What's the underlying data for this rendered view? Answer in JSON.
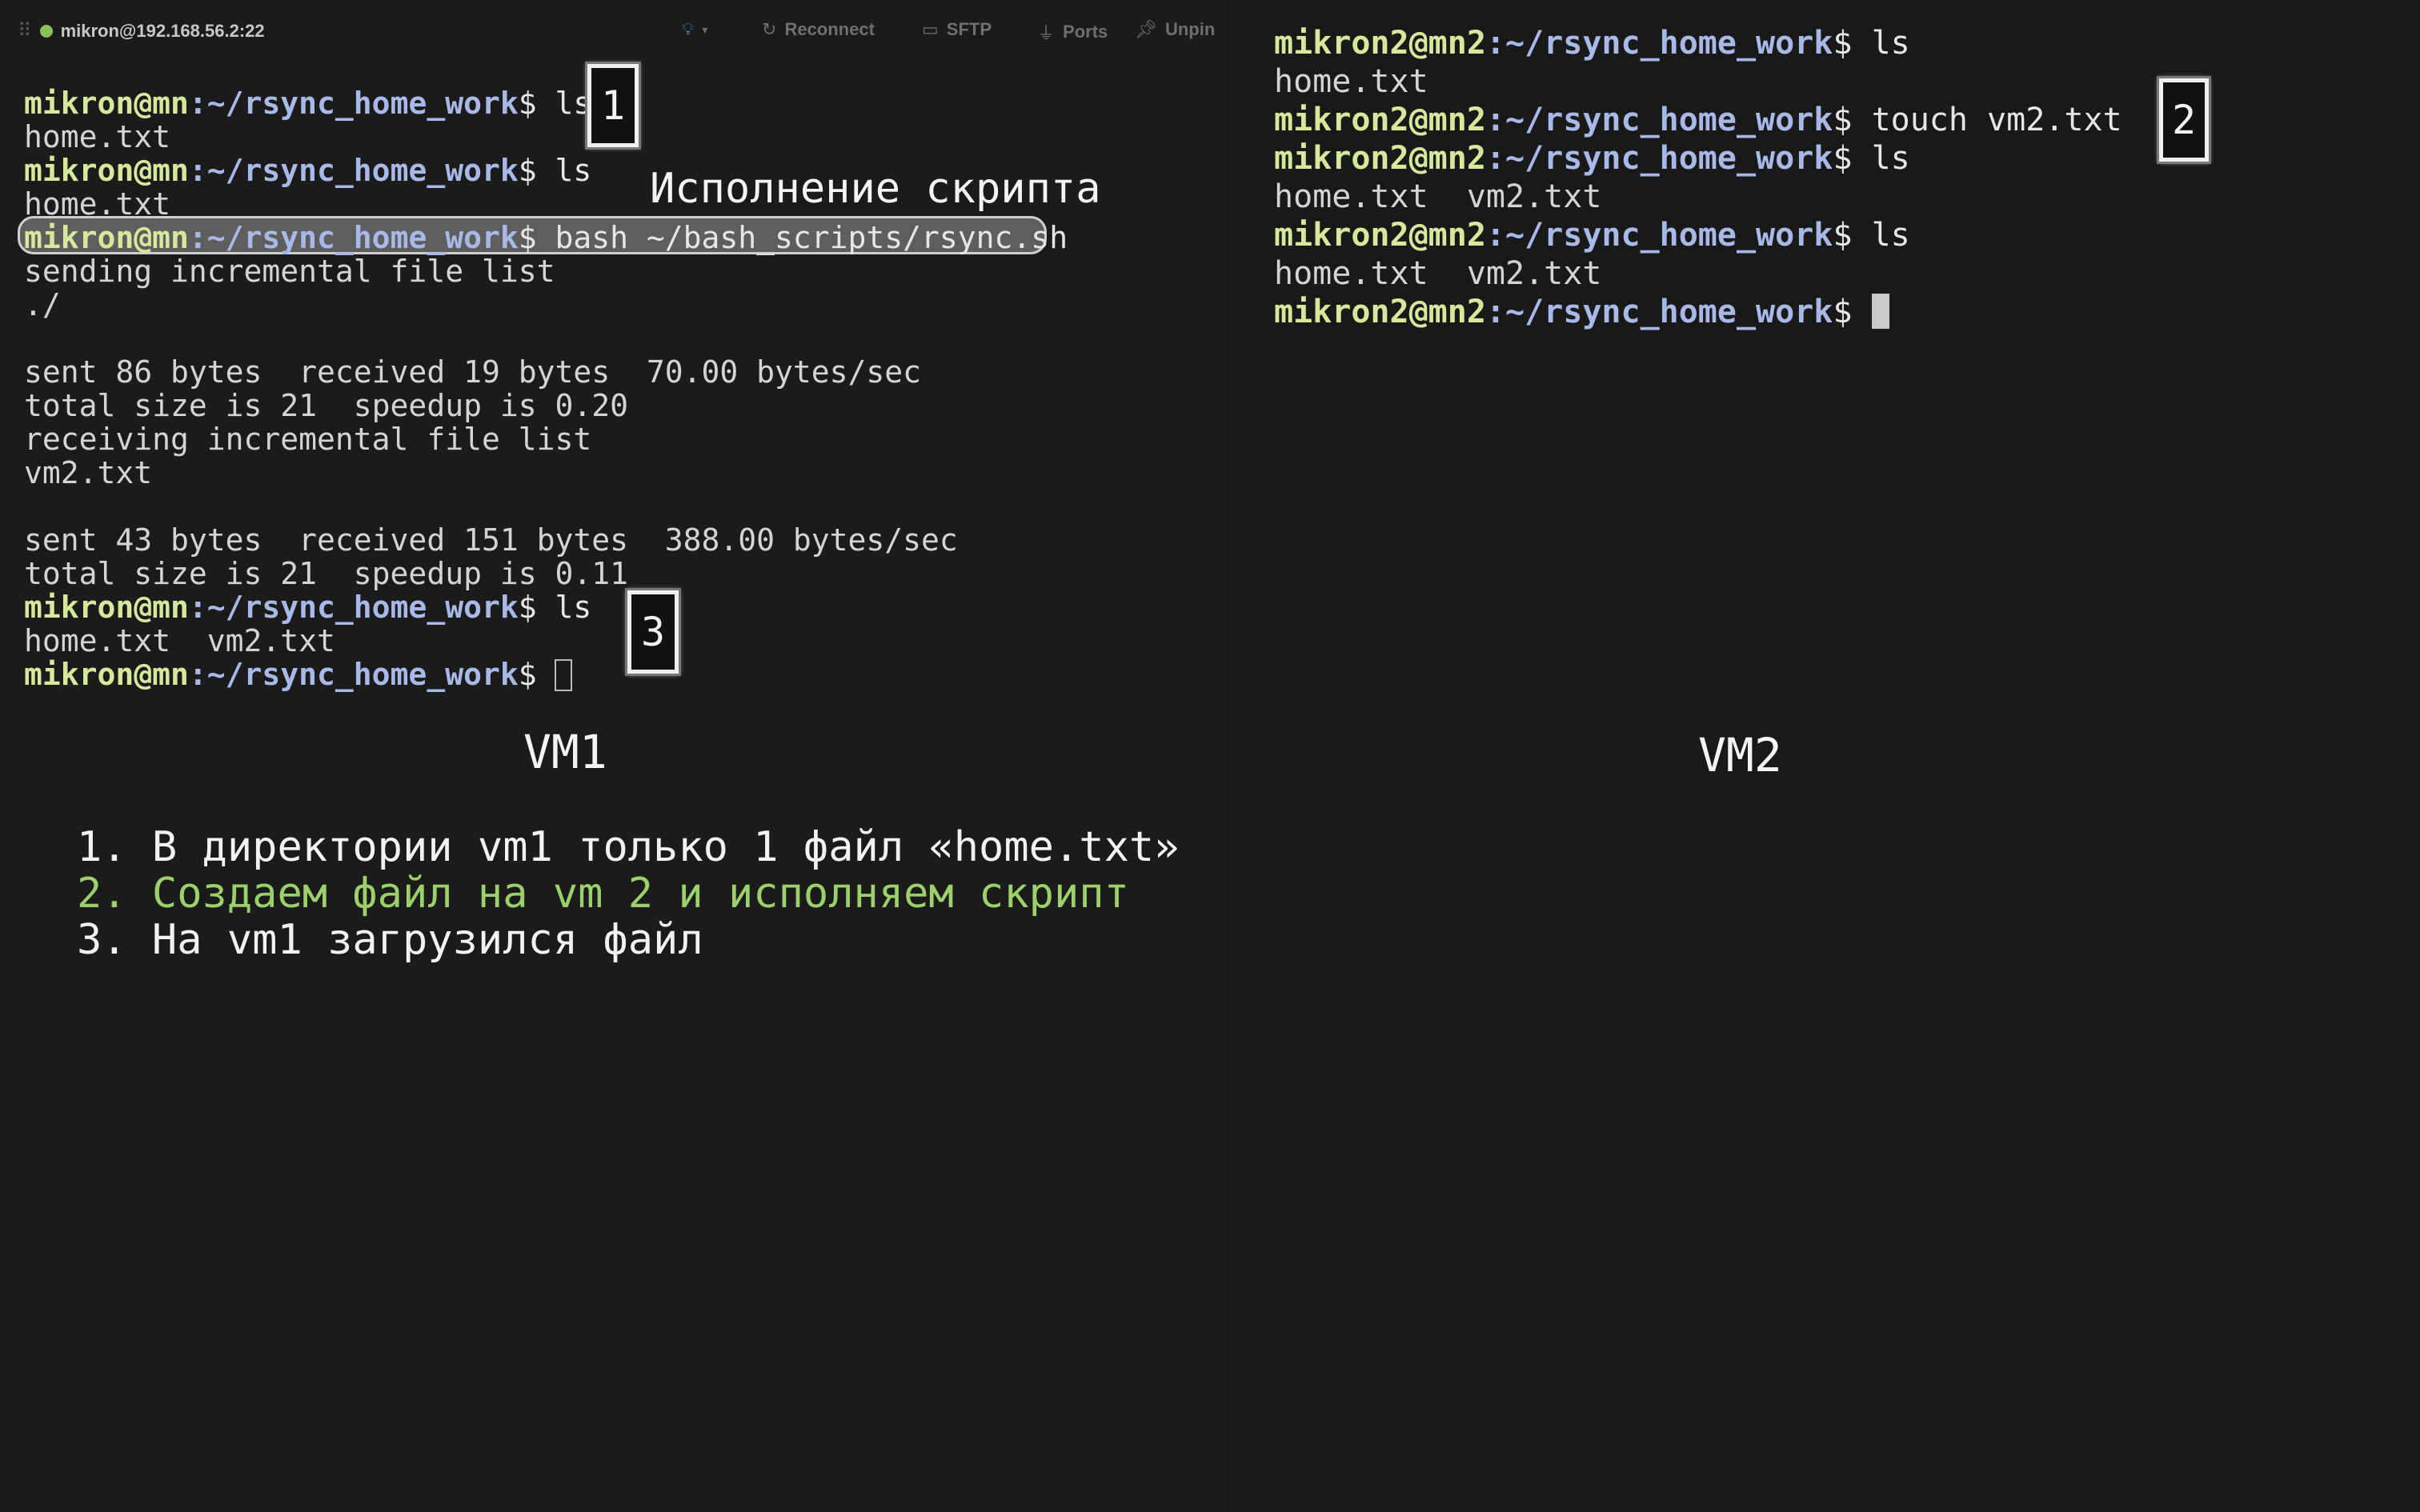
{
  "toolbar": {
    "host": "mikron@192.168.56.2:22",
    "reconnect": "Reconnect",
    "sftp": "SFTP",
    "ports": "Ports",
    "unpin": "Unpin",
    "status_color": "#8bbf5a"
  },
  "vm1": {
    "prompt_user": "mikron@mn",
    "prompt_path": ":~/rsync_home_work",
    "prompt_sign": "$ ",
    "lines": [
      {
        "type": "cmd",
        "text": "ls"
      },
      {
        "type": "out",
        "text": "home.txt"
      },
      {
        "type": "cmd",
        "text": "ls"
      },
      {
        "type": "out",
        "text": "home.txt"
      },
      {
        "type": "cmd",
        "text": "bash ~/bash_scripts/rsync.sh"
      },
      {
        "type": "out",
        "text": "sending incremental file list"
      },
      {
        "type": "out",
        "text": "./"
      },
      {
        "type": "out",
        "text": ""
      },
      {
        "type": "out",
        "text": "sent 86 bytes  received 19 bytes  70.00 bytes/sec"
      },
      {
        "type": "out",
        "text": "total size is 21  speedup is 0.20"
      },
      {
        "type": "out",
        "text": "receiving incremental file list"
      },
      {
        "type": "out",
        "text": "vm2.txt"
      },
      {
        "type": "out",
        "text": ""
      },
      {
        "type": "out",
        "text": "sent 43 bytes  received 151 bytes  388.00 bytes/sec"
      },
      {
        "type": "out",
        "text": "total size is 21  speedup is 0.11"
      },
      {
        "type": "cmd",
        "text": "ls"
      },
      {
        "type": "out",
        "text": "home.txt  vm2.txt"
      },
      {
        "type": "prompt",
        "text": ""
      }
    ],
    "label": "VM1",
    "script_annotation": "Исполнение скрипта"
  },
  "vm2": {
    "prompt_user": "mikron2@mn2",
    "prompt_path": ":~/rsync_home_work",
    "prompt_sign": "$ ",
    "lines": [
      {
        "type": "cmd",
        "text": "ls"
      },
      {
        "type": "out",
        "text": "home.txt"
      },
      {
        "type": "cmd",
        "text": "touch vm2.txt"
      },
      {
        "type": "cmd",
        "text": "ls"
      },
      {
        "type": "out",
        "text": "home.txt  vm2.txt"
      },
      {
        "type": "cmd",
        "text": "ls"
      },
      {
        "type": "out",
        "text": "home.txt  vm2.txt"
      },
      {
        "type": "prompt",
        "text": ""
      }
    ],
    "label": "VM2"
  },
  "badges": [
    "1",
    "2",
    "3"
  ],
  "notes": [
    {
      "text": "1. В директории vm1 только 1 файл «home.txt»",
      "color": "#f2f2f2"
    },
    {
      "text": "2. Создаем файл на vm 2 и исполняем скрипт",
      "color": "#9bd06a"
    },
    {
      "text": "3. На vm1 загрузился файл",
      "color": "#f2f2f2"
    }
  ]
}
